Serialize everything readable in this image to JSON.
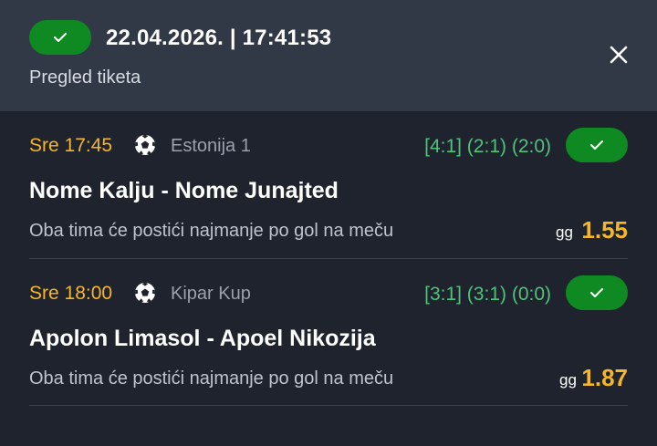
{
  "header": {
    "datetime": "22.04.2026. | 17:41:53",
    "subtitle": "Pregled tiketa",
    "status_icon": "check-icon",
    "close_icon": "close-icon"
  },
  "matches": [
    {
      "time": "Sre 17:45",
      "sport_icon": "soccer-ball-icon",
      "league": "Estonija 1",
      "score": "[4:1] (2:1) (2:0)",
      "teams": "Nome Kalju - Nome Junajted",
      "bet": "Oba tima će postići najmanje po gol na meču",
      "bet_code": "gg",
      "odds": "1.55"
    },
    {
      "time": "Sre 18:00",
      "sport_icon": "soccer-ball-icon",
      "league": "Kipar Kup",
      "score": "[3:1] (3:1) (0:0)",
      "teams": "Apolon Limasol - Apoel Nikozija",
      "bet": "Oba tima će postići najmanje po gol na meču",
      "bet_code": "gg",
      "odds": "1.87"
    }
  ],
  "colors": {
    "background": "#1e232d",
    "header": "#323946",
    "win_green": "#0f8a22",
    "time_yellow": "#f5b629",
    "score_green": "#4fc37a"
  }
}
